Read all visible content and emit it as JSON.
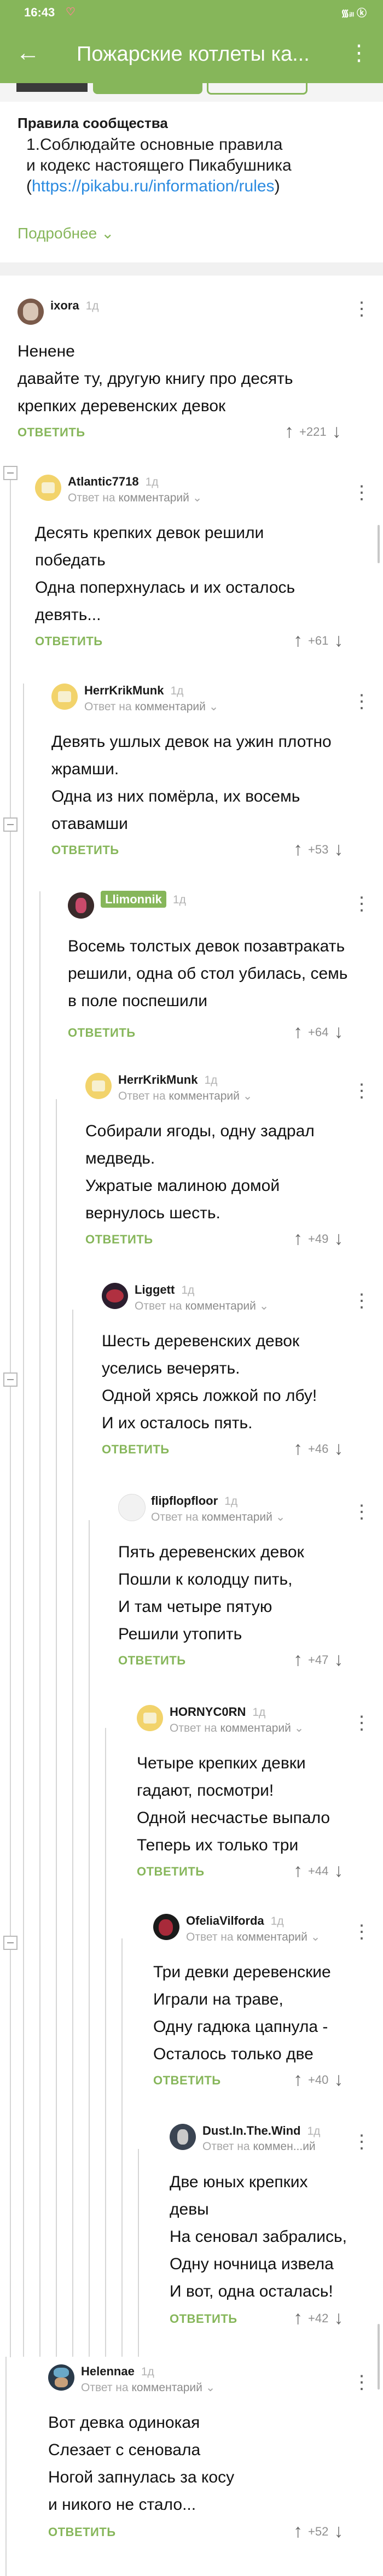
{
  "status_bar": {
    "time": "16:43",
    "heart": "♡",
    "right": "᯾ᵢₗₗ ⓚ"
  },
  "header": {
    "back_glyph": "←",
    "title": "Пожарские котлеты ка...",
    "menu_glyph": "⋮"
  },
  "rules": {
    "heading": "Правила сообщества",
    "line1": "1.Соблюдайте основные правила",
    "line2": "и кодекс настоящего Пикабушника",
    "paren_open": "(",
    "link": "https://pikabu.ru/information/rules",
    "paren_close": ")"
  },
  "more": {
    "label": "Подробнее",
    "chevron": "⌄"
  },
  "labels": {
    "reply": "ОТВЕТИТЬ",
    "reply_to_prefix": "Ответ на",
    "up_arrow": "↑",
    "down_arrow": "↓",
    "dots": "⋮",
    "chevron": "⌄"
  },
  "comments": [
    {
      "author": "ixora",
      "time": "1д",
      "text": "Ненене\nдавайте ту, другую книгу про десять\nкрепких деревенских девок",
      "score": "+221",
      "reply_to": ""
    },
    {
      "author": "Atlantic7718",
      "time": "1д",
      "text": "Десять крепких девок решили\nпобедать\nОдна поперхнулась и их осталось\nдевять...",
      "score": "+61",
      "reply_to": "комментарий"
    },
    {
      "author": "HerrKrikMunk",
      "time": "1д",
      "text": "Девять ушлых девок на ужин плотно\nжрамши.\nОдна из них помёрла, их восемь\nотавамши",
      "score": "+53",
      "reply_to": "комментарий"
    },
    {
      "author": "Llimonnik",
      "time": "1д",
      "text": "Восемь толстых девок позавтракать\nрешили, одна об стол убилась, семь\nв поле поспешили",
      "score": "+64",
      "reply_to": "комментарий"
    },
    {
      "author": "HerrKrikMunk",
      "time": "1д",
      "text": "Собирали ягоды, одну задрал\nмедведь.\nУжратые малиною домой\nвернулось шесть.",
      "score": "+49",
      "reply_to": "комментарий"
    },
    {
      "author": "Liggett",
      "time": "1д",
      "text": "Шесть деревенских девок\nуселись вечерять.\nОдной хрясь ложкой по лбу!\nИ их осталось пять.",
      "score": "+46",
      "reply_to": "комментарий"
    },
    {
      "author": "flipflopfloor",
      "time": "1д",
      "text": "Пять деревенских девок\nПошли к колодцу пить,\nИ там четыре пятую\nРешили утопить",
      "score": "+47",
      "reply_to": "комментарий"
    },
    {
      "author": "HORNYC0RN",
      "time": "1д",
      "text": "Четыре крепких девки\nгадают, посмотри!\nОдной несчастье выпало\nТеперь их только три",
      "score": "+44",
      "reply_to": "комментарий"
    },
    {
      "author": "OfeliaVilforda",
      "time": "1д",
      "text": "Три девки деревенские\nИграли на траве,\nОдну гадюка цапнула -\nОсталось только две",
      "score": "+40",
      "reply_to": "комментарий"
    },
    {
      "author": "Dust.In.The.Wind",
      "time": "1д",
      "text": "Две юных крепких\nдевы\nНа сеновал забрались,\nОдну ночница извела\nИ вот, одна осталась!",
      "score": "+42",
      "reply_to": "коммен...ий"
    },
    {
      "author": "Helennae",
      "time": "1д",
      "text": "Вот девка одинокая\nСлезает с сеновала\nНогой запнулась за косу\nи никого не стало...",
      "score": "+52",
      "reply_to": "комментарий"
    }
  ],
  "colors": {
    "accent": "#86b65a",
    "link": "#2a8ae0"
  }
}
